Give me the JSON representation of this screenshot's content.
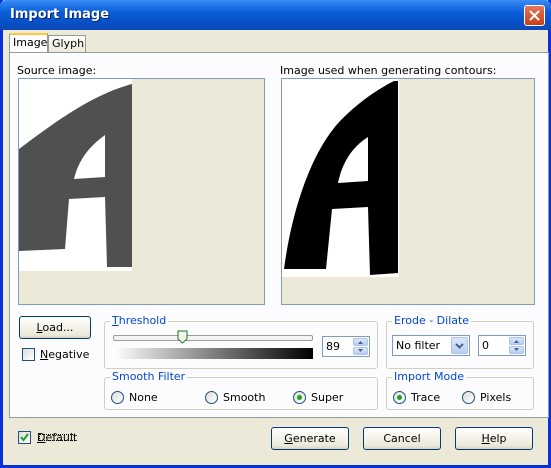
{
  "window": {
    "title": "Import Image"
  },
  "tabs": [
    {
      "label": "Image",
      "active": true
    },
    {
      "label": "Glyph",
      "active": false
    }
  ],
  "source_image": {
    "label": "Source image:",
    "glyph": "A"
  },
  "contour_image": {
    "label": "Image used when generating contours:",
    "glyph": "A"
  },
  "load_button": {
    "prefix": "L",
    "rest": "oad..."
  },
  "negative": {
    "prefix": "N",
    "rest": "egative",
    "checked": false
  },
  "threshold": {
    "title_prefix": "T",
    "title_rest": "hreshold",
    "value": "89",
    "slider_fraction": 0.35
  },
  "erode_dilate": {
    "title": "Erode - Dilate",
    "filter_value": "No filter",
    "amount": "0"
  },
  "smooth_filter": {
    "title": "Smooth Filter",
    "options": [
      {
        "label": "None",
        "selected": false
      },
      {
        "label": "Smooth",
        "selected": false
      },
      {
        "label": "Super",
        "selected": true
      }
    ]
  },
  "import_mode": {
    "title": "Import Mode",
    "options": [
      {
        "label": "Trace",
        "selected": true
      },
      {
        "label": "Pixels",
        "selected": false
      }
    ]
  },
  "default_checkbox": {
    "prefix": "D",
    "rest": "efault",
    "checked": true
  },
  "footer": {
    "generate": {
      "prefix": "G",
      "rest": "enerate"
    },
    "cancel": "Cancel",
    "help": {
      "prefix": "H",
      "rest": "elp"
    }
  },
  "colors": {
    "title_blue": "#0a5fd8",
    "group_title": "#0046d5",
    "radio_dot": "#21a121"
  }
}
